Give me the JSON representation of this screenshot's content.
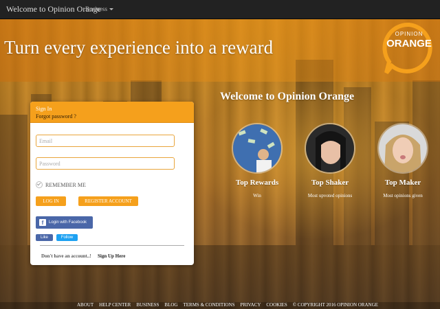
{
  "navbar": {
    "brand": "Welcome to Opinion Orange",
    "business": "Business"
  },
  "hero": {
    "tagline": "Turn every experience into a reward",
    "logo_top": "OPINION",
    "logo_main": "ORANGE"
  },
  "login": {
    "signin": "Sign In",
    "forgot": "Forgot password ?",
    "email_placeholder": "Email",
    "password_placeholder": "Password",
    "remember": "REMEMBER ME",
    "login_button": "LOG IN",
    "register_button": "REGISTER ACCOUNT",
    "facebook_login": "Login with Facebook",
    "like": "Like",
    "follow": "Follow",
    "no_account": "Don't have an account..!",
    "signup": "Sign Up Here"
  },
  "welcome": {
    "heading": "Welcome to Opinion Orange",
    "awards": [
      {
        "title": "Top Rewards",
        "subtitle": "Win"
      },
      {
        "title": "Top Shaker",
        "subtitle": "Most upvoted opinions"
      },
      {
        "title": "Top Maker",
        "subtitle": "Most opinions given"
      }
    ]
  },
  "footer": {
    "links": [
      "ABOUT",
      "HELP CENTER",
      "BUSINESS",
      "BLOG",
      "TERMS & CONDITIONS",
      "PRIVACY",
      "COOKIES",
      "© COPYRIGHT 2016 OPINION ORANGE"
    ]
  },
  "colors": {
    "accent": "#f5a01c",
    "navbar": "#222222",
    "facebook": "#4a67a8",
    "twitter": "#1da1f2"
  }
}
